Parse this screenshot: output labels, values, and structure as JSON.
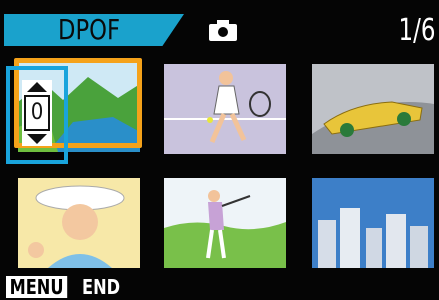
{
  "header": {
    "mode": "DPOF",
    "counter": "1/6",
    "mode_color": "#1aa2cc"
  },
  "selection": {
    "quantity": "0",
    "frame_color": "#f5a21a",
    "cursor_color": "#19a4dc"
  },
  "footer": {
    "menu_key": "MENU",
    "menu_action": "END"
  },
  "thumbnails": [
    {
      "subject": "landscape-lake"
    },
    {
      "subject": "tennis-player"
    },
    {
      "subject": "sports-car"
    },
    {
      "subject": "woman-portrait"
    },
    {
      "subject": "golfer"
    },
    {
      "subject": "city-skyline"
    }
  ]
}
